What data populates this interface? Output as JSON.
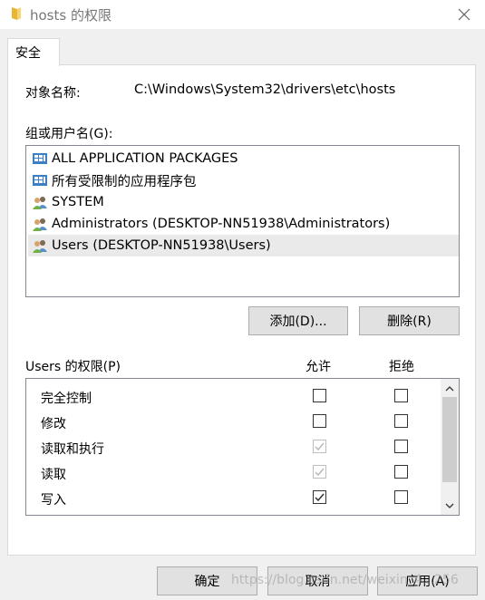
{
  "window": {
    "title": "hosts 的权限",
    "tab_label": "安全"
  },
  "object": {
    "label": "对象名称:",
    "value": "C:\\Windows\\System32\\drivers\\etc\\hosts"
  },
  "groups": {
    "label": "组或用户名(G):",
    "items": [
      {
        "label": "ALL APPLICATION PACKAGES",
        "icon": "app-package-icon",
        "selected": false
      },
      {
        "label": "所有受限制的应用程序包",
        "icon": "app-package-icon",
        "selected": false
      },
      {
        "label": "SYSTEM",
        "icon": "user-group-icon",
        "selected": false
      },
      {
        "label": "Administrators (DESKTOP-NN51938\\Administrators)",
        "icon": "user-group-icon",
        "selected": false
      },
      {
        "label": "Users (DESKTOP-NN51938\\Users)",
        "icon": "user-group-icon",
        "selected": true
      }
    ],
    "add_button": "添加(D)...",
    "remove_button": "删除(R)"
  },
  "permissions": {
    "label": "Users 的权限(P)",
    "allow_header": "允许",
    "deny_header": "拒绝",
    "rows": [
      {
        "name": "完全控制",
        "allow": false,
        "allow_disabled": false,
        "deny": false
      },
      {
        "name": "修改",
        "allow": false,
        "allow_disabled": false,
        "deny": false
      },
      {
        "name": "读取和执行",
        "allow": true,
        "allow_disabled": true,
        "deny": false
      },
      {
        "name": "读取",
        "allow": true,
        "allow_disabled": true,
        "deny": false
      },
      {
        "name": "写入",
        "allow": true,
        "allow_disabled": false,
        "deny": false
      }
    ]
  },
  "footer": {
    "ok": "确定",
    "cancel": "取消",
    "apply": "应用(A)"
  },
  "watermark": "https://blog.csdn.net/weixin_4...256",
  "colors": {
    "folder": "#f2c84b",
    "selected_row": "#eaeaea",
    "button_bg": "#e1e1e1"
  }
}
